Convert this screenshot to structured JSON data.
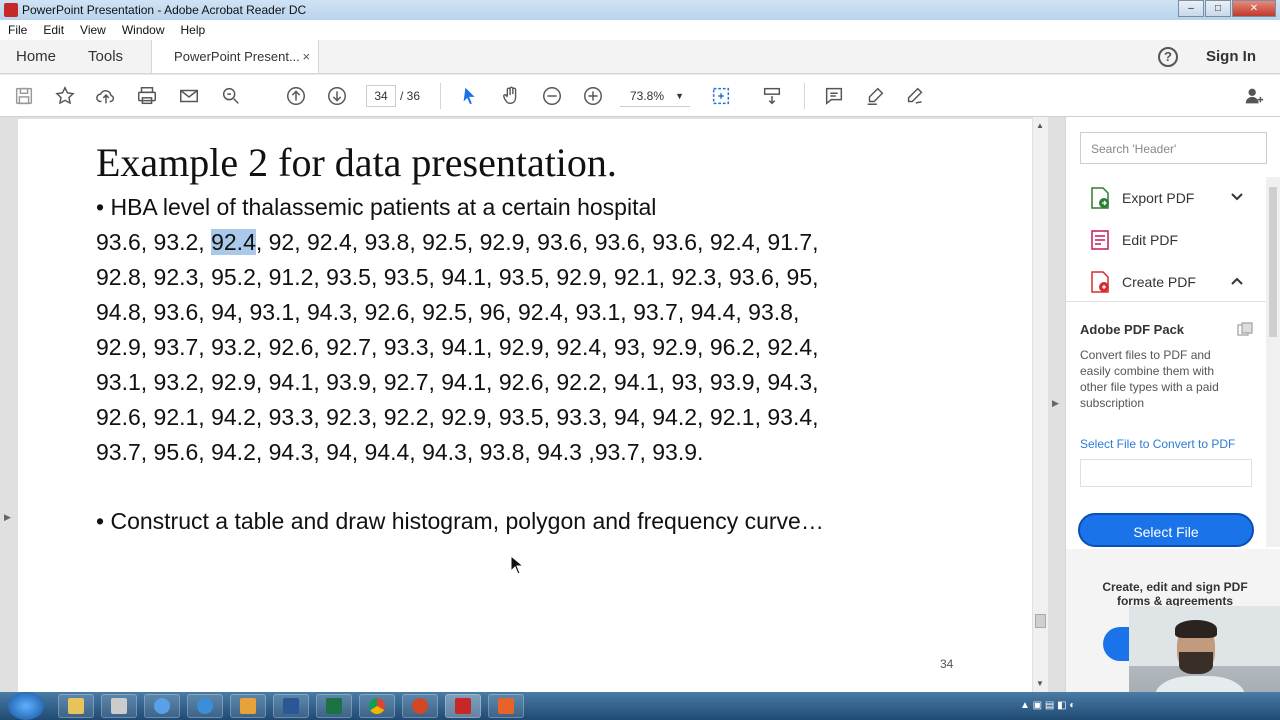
{
  "window": {
    "title": "PowerPoint Presentation - Adobe Acrobat Reader DC",
    "min": "–",
    "max": "□",
    "close": "✕"
  },
  "menu": [
    "File",
    "Edit",
    "View",
    "Window",
    "Help"
  ],
  "tabs": {
    "home": "Home",
    "tools": "Tools",
    "doc": "PowerPoint Present...",
    "close": "×",
    "help": "?",
    "signin": "Sign In"
  },
  "toolbar": {
    "page_current": "34",
    "page_total": "/ 36",
    "zoom": "73.8%"
  },
  "slide": {
    "title": "Example 2 for data presentation.",
    "bullet1": "HBA level of thalassemic patients at a certain hospital",
    "line1_pre": "93.6, 93.2, ",
    "line1_hl": "92.4",
    "line1_post": ", 92, 92.4, 93.8, 92.5, 92.9, 93.6, 93.6, 93.6, 92.4, 91.7,",
    "lines": [
      "92.8, 92.3, 95.2, 91.2, 93.5, 93.5, 94.1, 93.5, 92.9, 92.1, 92.3, 93.6, 95,",
      "94.8, 93.6, 94, 93.1, 94.3, 92.6, 92.5, 96, 92.4, 93.1, 93.7, 94.4, 93.8,",
      "92.9, 93.7, 93.2, 92.6, 92.7, 93.3, 94.1, 92.9, 92.4, 93, 92.9, 96.2, 92.4,",
      "93.1, 93.2, 92.9, 94.1, 93.9, 92.7, 94.1, 92.6, 92.2, 94.1, 93, 93.9, 94.3,",
      "92.6, 92.1, 94.2, 93.3, 92.3, 92.2, 92.9, 93.5, 93.3, 94, 94.2, 92.1, 93.4,",
      "93.7, 95.6, 94.2, 94.3, 94, 94.4, 94.3, 93.8, 94.3 ,93.7, 93.9."
    ],
    "bullet2": "Construct a table and draw histogram, polygon and frequency curve…",
    "page_number": "34"
  },
  "right_panel": {
    "search_placeholder": "Search 'Header'",
    "export": "Export PDF",
    "edit": "Edit PDF",
    "create": "Create PDF",
    "pack_title": "Adobe PDF Pack",
    "pack_desc": "Convert files to PDF and easily combine them with other file types with a paid subscription",
    "convert_label": "Select File to Convert to PDF",
    "select_button": "Select File",
    "promo": "Create, edit and sign PDF forms & agreements"
  },
  "colors": {
    "accent": "#1a73e8",
    "highlight": "#a9c8ea",
    "export_icon": "#2e7d32",
    "edit_icon": "#c2185b",
    "create_icon": "#d32f2f"
  }
}
